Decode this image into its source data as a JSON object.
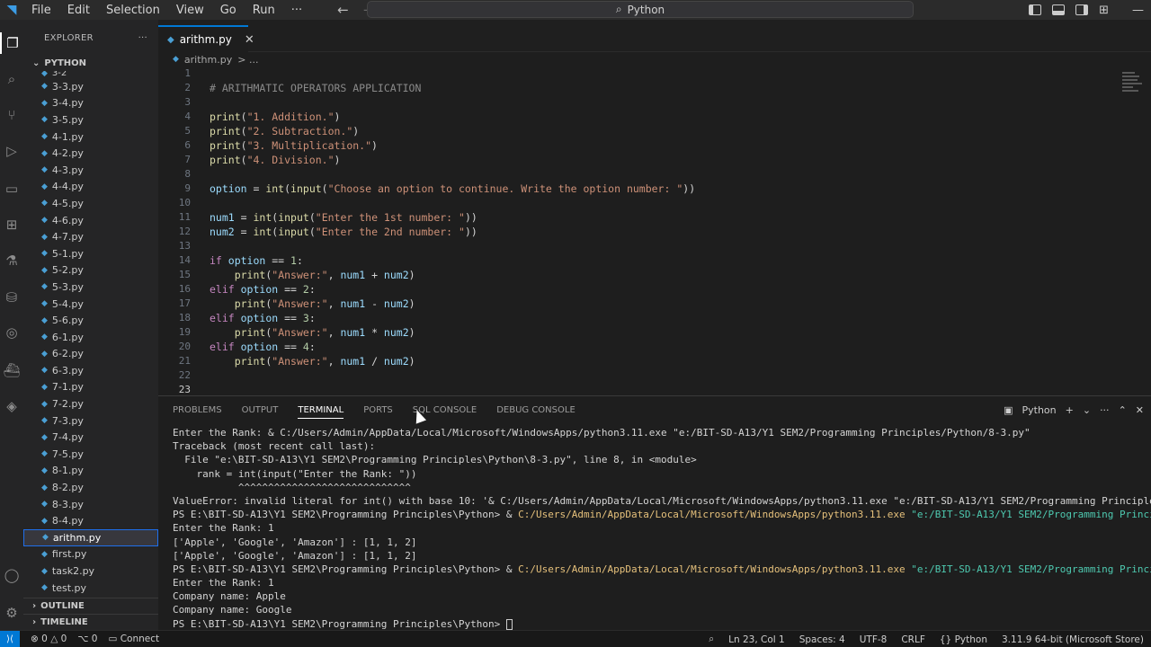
{
  "titlebar": {
    "menu": [
      "File",
      "Edit",
      "Selection",
      "View",
      "Go",
      "Run",
      "···"
    ],
    "search_text": "Python"
  },
  "sidebar": {
    "title": "EXPLORER",
    "more": "···",
    "folder": "PYTHON",
    "files": [
      "3-2",
      "3-3.py",
      "3-4.py",
      "3-5.py",
      "4-1.py",
      "4-2.py",
      "4-3.py",
      "4-4.py",
      "4-5.py",
      "4-6.py",
      "4-7.py",
      "5-1.py",
      "5-2.py",
      "5-3.py",
      "5-4.py",
      "5-6.py",
      "6-1.py",
      "6-2.py",
      "6-3.py",
      "7-1.py",
      "7-2.py",
      "7-3.py",
      "7-4.py",
      "7-5.py",
      "8-1.py",
      "8-2.py",
      "8-3.py",
      "8-4.py",
      "arithm.py",
      "first.py",
      "task2.py",
      "test.py"
    ],
    "active_file": "arithm.py",
    "outline": "OUTLINE",
    "timeline": "TIMELINE"
  },
  "editor": {
    "tab": "arithm.py",
    "breadcrumb_file": "arithm.py",
    "breadcrumb_sep": "> ...",
    "line_numbers": [
      "1",
      "2",
      "3",
      "4",
      "5",
      "6",
      "7",
      "8",
      "9",
      "10",
      "11",
      "12",
      "13",
      "14",
      "15",
      "16",
      "17",
      "18",
      "19",
      "20",
      "21",
      "22",
      "23"
    ]
  },
  "panel": {
    "tabs": [
      "PROBLEMS",
      "OUTPUT",
      "TERMINAL",
      "PORTS",
      "SQL CONSOLE",
      "DEBUG CONSOLE"
    ],
    "active_tab": "TERMINAL",
    "shell": "Python",
    "terminal": {
      "l1": "Enter the Rank: & C:/Users/Admin/AppData/Local/Microsoft/WindowsApps/python3.11.exe \"e:/BIT-SD-A13/Y1 SEM2/Programming Principles/Python/8-3.py\"",
      "l2": "Traceback (most recent call last):",
      "l3": "  File \"e:\\BIT-SD-A13\\Y1 SEM2\\Programming Principles\\Python\\8-3.py\", line 8, in <module>",
      "l4": "    rank = int(input(\"Enter the Rank: \"))",
      "l5": "           ^^^^^^^^^^^^^^^^^^^^^^^^^^^^^",
      "l6": "ValueError: invalid literal for int() with base 10: '& C:/Users/Admin/AppData/Local/Microsoft/WindowsApps/python3.11.exe \"e:/BIT-SD-A13/Y1 SEM2/Programming Principles/Python/8-3.p",
      "prompt": "PS E:\\BIT-SD-A13\\Y1 SEM2\\Programming Principles\\Python> ",
      "amp": "& ",
      "exe": "C:/Users/Admin/AppData/Local/Microsoft/WindowsApps/python3.11.exe",
      "script": " \"e:/BIT-SD-A13/Y1 SEM2/Programming Principles/Python/8-",
      "l8": "Enter the Rank: 1",
      "l9": "['Apple', 'Google', 'Amazon'] : [1, 1, 2]",
      "l10": "['Apple', 'Google', 'Amazon'] : [1, 1, 2]",
      "l12": "Enter the Rank: 1",
      "l13": "Company name: Apple",
      "l14": "Company name: Google",
      "final_prompt": "PS E:\\BIT-SD-A13\\Y1 SEM2\\Programming Principles\\Python> "
    }
  },
  "statusbar": {
    "errors": "0",
    "warnings": "0",
    "info": "0",
    "connect": "Connect",
    "position": "Ln 23, Col 1",
    "spaces": "Spaces: 4",
    "encoding": "UTF-8",
    "eol": "CRLF",
    "language": "Python",
    "interpreter": "3.11.9 64-bit (Microsoft Store)"
  }
}
